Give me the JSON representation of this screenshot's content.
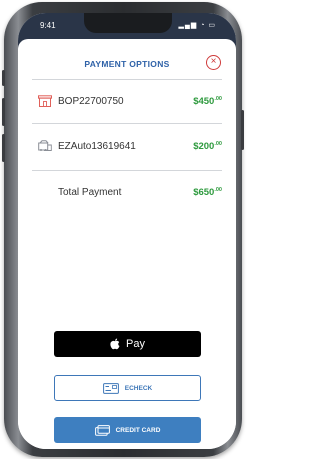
{
  "statusbar": {
    "time": "9:41",
    "indicators": "▂▄▆ ◔ ▭"
  },
  "header": {
    "title": "PAYMENT OPTIONS",
    "close_symbol": "×"
  },
  "items": [
    {
      "icon": "building-icon",
      "label": "BOP22700750",
      "amount_main": "$450",
      "amount_cents": ".00"
    },
    {
      "icon": "car-icon",
      "label": "EZAuto13619641",
      "amount_main": "$200",
      "amount_cents": ".00"
    }
  ],
  "total": {
    "label": "Total Payment",
    "amount_main": "$650",
    "amount_cents": ".00"
  },
  "buttons": {
    "apple_pay_label": "Pay",
    "echeck_label": "ECHECK",
    "credit_card_label": "CREDIT CARD"
  },
  "colors": {
    "accent_blue": "#2f62a8",
    "amount_green": "#2e9a3e",
    "close_red": "#cf3a3a",
    "credit_button": "#3e7fc0"
  }
}
